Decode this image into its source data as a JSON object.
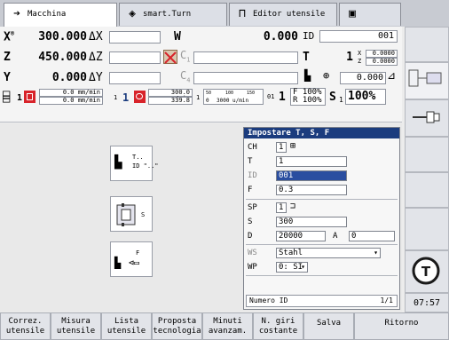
{
  "tabs": [
    {
      "label": "Macchina",
      "icon": "arrow-right-icon"
    },
    {
      "label": "smart.Turn",
      "icon": "diamond-arrow-icon"
    },
    {
      "label": "Editor utensile",
      "icon": "tool-icon"
    },
    {
      "label": "",
      "icon": "save-icon"
    }
  ],
  "status": {
    "x_label": "X",
    "x_sup": "®",
    "x_value": "300.000",
    "dx_label": "ΔX",
    "z_label": "Z",
    "z_value": "450.000",
    "dz_label": "ΔZ",
    "y_label": "Y",
    "y_value": "0.000",
    "dy_label": "ΔY",
    "w_label": "W",
    "w_value": "0.000",
    "id_label": "ID",
    "id_value": "001",
    "c1_label": "C",
    "c1_sub": "1",
    "c4_label": "C",
    "c4_sub": "4",
    "t_label": "T",
    "t_value": "1",
    "tx_label": "X",
    "tx_value": "0.0000",
    "tz_label": "Z",
    "tz_value": "0.0000",
    "angle_value": "0.000",
    "feed_top": "0.0 mm/min",
    "feed_bottom": "0.0 mm/min",
    "s1_channel": "1",
    "spindle_num": "1",
    "spindle_feed_top": "300.0 m/min",
    "spindle_feed_bottom": "339.8",
    "scale_small_a": "1",
    "scale_ticks": [
      "50",
      "100",
      "150"
    ],
    "scale_zero": "0",
    "scale_value": "3000 u/min",
    "gear_label": "01",
    "ovr_f_label": "F",
    "ovr_f": "100%",
    "ovr_r_label": "R",
    "ovr_r": "100%",
    "ovr_one": "1",
    "ovr_s_label": "S",
    "ovr_s_channel": "1",
    "ovr_s": "100%"
  },
  "work": {
    "btn1_line1": "T..",
    "btn1_line2": "ID \"..\"",
    "btn2_label": "S",
    "btn3_label": "F"
  },
  "dialog": {
    "title": "Impostare T, S, F",
    "ch_label": "CH",
    "ch_value": "1",
    "t_label": "T",
    "t_value": "1",
    "id_label": "ID",
    "id_value": "001",
    "f_label": "F",
    "f_value": "0.3",
    "sp_label": "SP",
    "sp_value": "1",
    "s_label": "S",
    "s_value": "300",
    "d_label": "D",
    "d_value": "20000",
    "a_label": "A",
    "a_value": "0",
    "ws_label": "WS",
    "ws_value": "Stahl",
    "wp_label": "WP",
    "wp_value": "0: SI",
    "footer_label": "Numero ID",
    "footer_page": "1/1"
  },
  "clock": "07:57",
  "softkeys": [
    {
      "line1": "Correz.",
      "line2": "utensile"
    },
    {
      "line1": "Misura",
      "line2": "utensile"
    },
    {
      "line1": "Lista",
      "line2": "utensile"
    },
    {
      "line1": "Proposta",
      "line2": "tecnologia"
    },
    {
      "line1": "Minuti",
      "line2": "avanzam."
    },
    {
      "line1": "N. giri",
      "line2": "costante"
    },
    {
      "line1": "Salva",
      "line2": ""
    },
    {
      "line1": "Ritorno",
      "line2": ""
    }
  ],
  "colors": {
    "accent": "#1b3c7e",
    "selection": "#2a4ea0",
    "warning_red": "#d8232a"
  }
}
